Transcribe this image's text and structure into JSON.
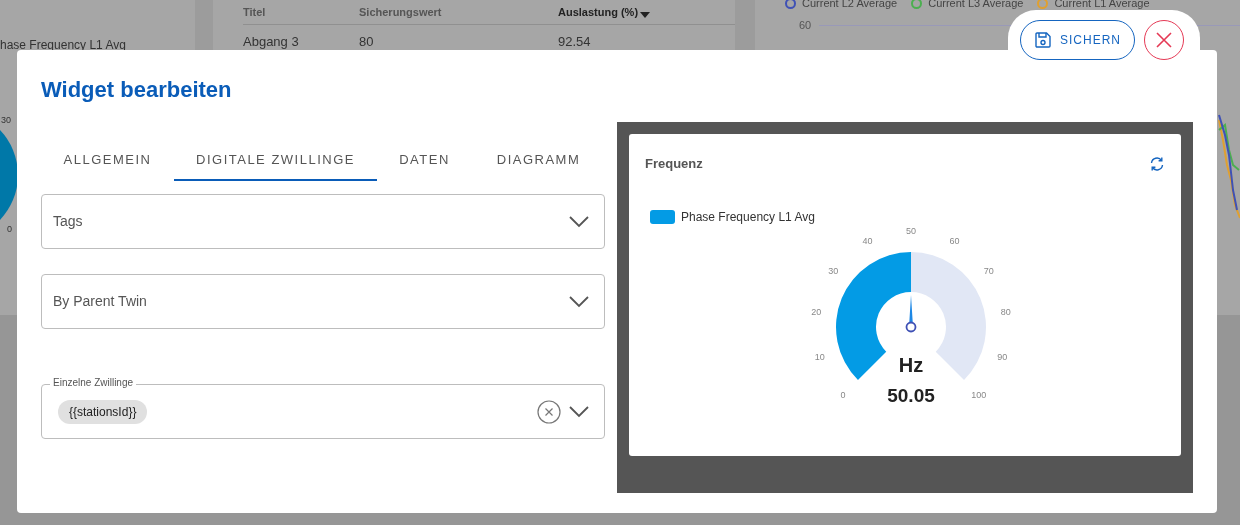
{
  "background": {
    "left_card": {
      "legend": "hase Frequency L1 Avg",
      "ticks": [
        "30",
        "0"
      ]
    },
    "table": {
      "columns": [
        "Titel",
        "Sicherungswert",
        "Auslastung (%)"
      ],
      "rows": [
        [
          "Abgang 3",
          "80",
          "92.54"
        ]
      ]
    },
    "right_chart": {
      "legend": [
        {
          "label": "Current L2 Average",
          "color": "#3f51b5"
        },
        {
          "label": "Current L3 Average",
          "color": "#4caf50"
        },
        {
          "label": "Current L1 Average",
          "color": "#e0a030"
        }
      ],
      "tick": "60"
    }
  },
  "dialog": {
    "title": "Widget bearbeiten",
    "save_button": "SICHERN",
    "tabs": [
      {
        "label": "ALLGEMEIN",
        "selected": false
      },
      {
        "label": "DIGITALE ZWILLINGE",
        "selected": true
      },
      {
        "label": "DATEN",
        "selected": false
      },
      {
        "label": "DIAGRAMM",
        "selected": false
      }
    ],
    "fields": [
      {
        "kind": "select",
        "value": "Tags"
      },
      {
        "kind": "select",
        "value": "By Parent Twin"
      },
      {
        "kind": "multiselect",
        "label": "Einzelne Zwillinge",
        "chips": [
          "{{stationsId}}"
        ]
      }
    ],
    "preview": {
      "title": "Frequenz",
      "legend": "Phase Frequency L1 Avg",
      "unit": "Hz",
      "reading": "50.05",
      "level": 0.5,
      "ticks": [
        "0",
        "10",
        "20",
        "30",
        "40",
        "50",
        "60",
        "70",
        "80",
        "90",
        "100"
      ]
    }
  }
}
